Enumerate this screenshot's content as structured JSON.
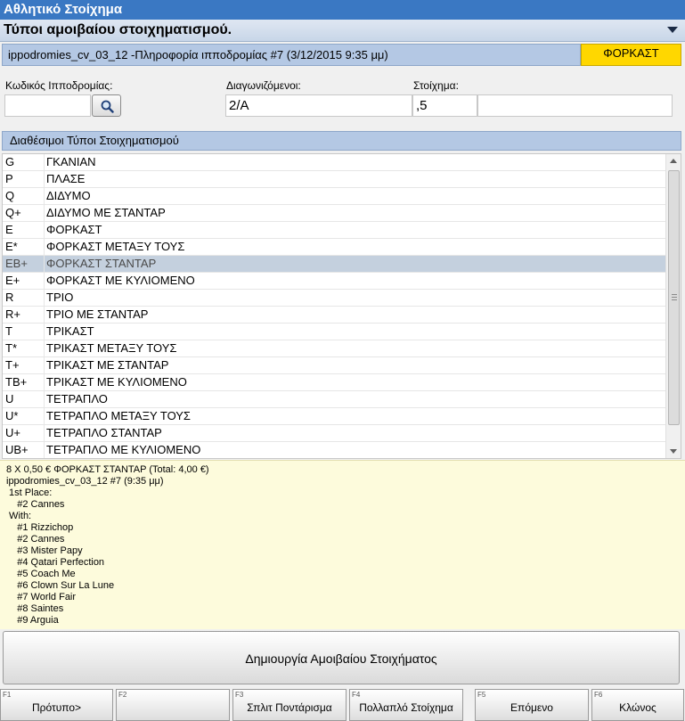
{
  "window": {
    "title": "Αθλητικό Στοίχημα"
  },
  "header": {
    "title": "Τύποι αμοιβαίου στοιχηματισμού."
  },
  "event": {
    "description": "ippodromies_cv_03_12 -Πληροφορία ιπποδρομίας #7 (3/12/2015 9:35 μμ)",
    "bet_type_badge": "ΦΟΡΚΑΣΤ"
  },
  "form": {
    "race_code_label": "Κωδικός Ιπποδρομίας:",
    "race_code_value": "",
    "runners_label": "Διαγωνιζόμενοι:",
    "runners_value": "2/A",
    "stake_label": "Στοίχημα:",
    "stake_value": ",5",
    "extra_value": ""
  },
  "bet_types": {
    "header": "Διαθέσιμοι Τύποι Στοιχηματισμού",
    "selected_code": "EB+",
    "items": [
      {
        "code": "G",
        "name": "ΓΚΑΝΙΑΝ"
      },
      {
        "code": "P",
        "name": "ΠΛΑΣΕ"
      },
      {
        "code": "Q",
        "name": "ΔΙΔΥΜΟ"
      },
      {
        "code": "Q+",
        "name": "ΔΙΔΥΜΟ ΜΕ ΣΤΑΝΤΑΡ"
      },
      {
        "code": "E",
        "name": "ΦΟΡΚΑΣΤ"
      },
      {
        "code": "E*",
        "name": "ΦΟΡΚΑΣΤ ΜΕΤΑΞΥ ΤΟΥΣ"
      },
      {
        "code": "EB+",
        "name": "ΦΟΡΚΑΣΤ ΣΤΑΝΤΑΡ"
      },
      {
        "code": "E+",
        "name": "ΦΟΡΚΑΣΤ ΜΕ ΚΥΛΙΟΜΕΝΟ"
      },
      {
        "code": "R",
        "name": "ΤΡΙΟ"
      },
      {
        "code": "R+",
        "name": "ΤΡΙΟ ΜΕ ΣΤΑΝΤΑΡ"
      },
      {
        "code": "T",
        "name": "ΤΡΙΚΑΣΤ"
      },
      {
        "code": "T*",
        "name": "ΤΡΙΚΑΣΤ ΜΕΤΑΞΥ ΤΟΥΣ"
      },
      {
        "code": "T+",
        "name": "ΤΡΙΚΑΣΤ ΜΕ ΣΤΑΝΤΑΡ"
      },
      {
        "code": "TB+",
        "name": "ΤΡΙΚΑΣΤ ΜΕ ΚΥΛΙΟΜΕΝΟ"
      },
      {
        "code": "U",
        "name": "ΤΕΤΡΑΠΛΟ"
      },
      {
        "code": "U*",
        "name": "ΤΕΤΡΑΠΛΟ ΜΕΤΑΞΥ ΤΟΥΣ"
      },
      {
        "code": "U+",
        "name": "ΤΕΤΡΑΠΛΟ ΣΤΑΝΤΑΡ"
      },
      {
        "code": "UB+",
        "name": "ΤΕΤΡΑΠΛΟ ΜΕ ΚΥΛΙΟΜΕΝΟ"
      }
    ]
  },
  "summary": {
    "lines": [
      "8 X 0,50 € ΦΟΡΚΑΣΤ ΣΤΑΝΤΑΡ (Total: 4,00 €)",
      "ippodromies_cv_03_12 #7 (9:35 μμ)",
      " 1st Place:",
      "    #2 Cannes",
      " With:",
      "    #1 Rizzichop",
      "    #2 Cannes",
      "    #3 Mister Papy",
      "    #4 Qatari Perfection",
      "    #5 Coach Me",
      "    #6 Clown Sur La Lune",
      "    #7 World Fair",
      "    #8 Saintes",
      "    #9 Arguia"
    ]
  },
  "create_button": {
    "label": "Δημιουργία Αμοιβαίου Στοιχήματος"
  },
  "function_keys": [
    {
      "key": "F1",
      "label": "Πρότυπο>"
    },
    {
      "key": "F2",
      "label": ""
    },
    {
      "key": "F3",
      "label": "Σπλιτ Ποντάρισμα"
    },
    {
      "key": "F4",
      "label": "Πολλαπλό Στοίχημα"
    },
    {
      "key": "F5",
      "label": "Επόμενο"
    },
    {
      "key": "F6",
      "label": "Κλώνος"
    }
  ],
  "colors": {
    "title_bar": "#3a78c3",
    "badge": "#ffd700",
    "section_header": "#b4c8e4",
    "selected_row": "#c4d0de",
    "summary_bg": "#fdfbdc"
  },
  "icons": {
    "search": "magnifier-icon",
    "collapse": "chevron-down-icon"
  }
}
